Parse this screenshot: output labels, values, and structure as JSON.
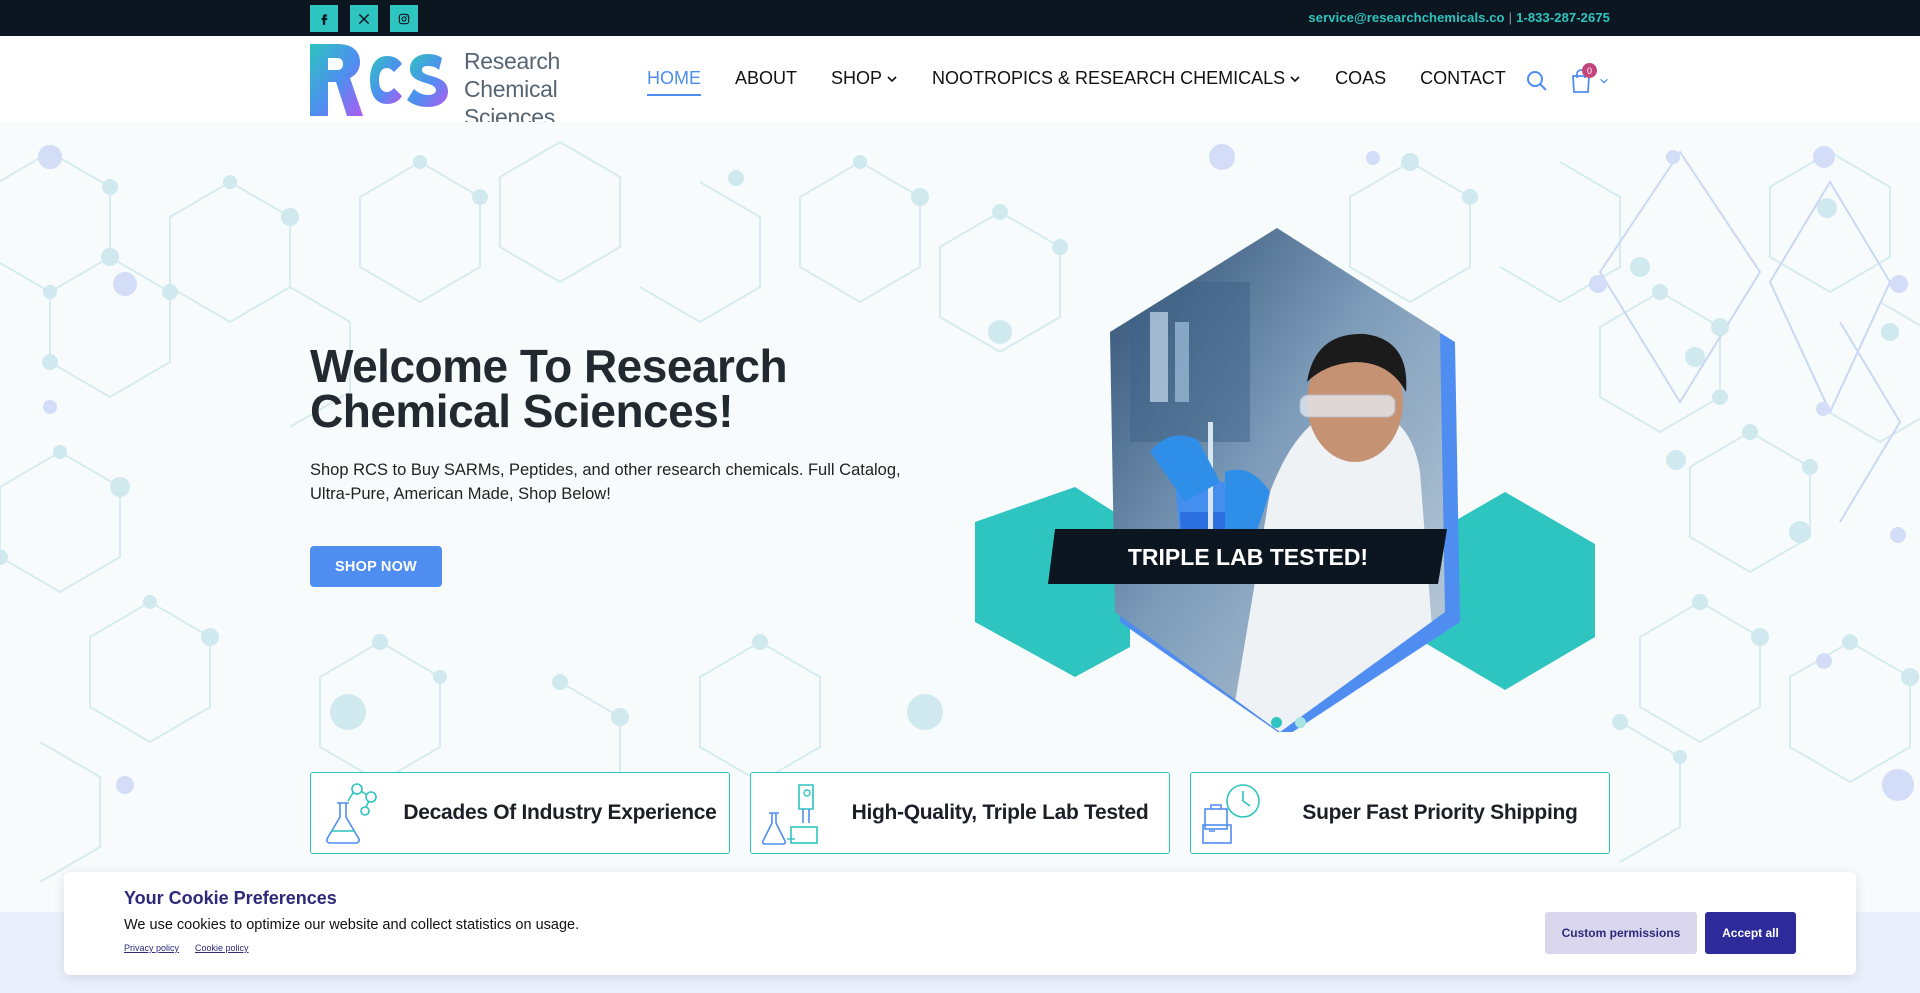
{
  "topbar": {
    "socials": [
      {
        "icon": "facebook-icon",
        "glyph": "f"
      },
      {
        "icon": "x-icon",
        "glyph": "𝕏"
      },
      {
        "icon": "instagram-icon",
        "glyph": "◎"
      }
    ],
    "email": "service@researchchemicals.co",
    "separator": "|",
    "phone": "1-833-287-2675"
  },
  "logo": {
    "line1": "Research",
    "line2": "Chemical",
    "line3": "Sciences"
  },
  "nav": {
    "items": [
      {
        "label": "HOME",
        "active": true
      },
      {
        "label": "ABOUT"
      },
      {
        "label": "SHOP",
        "dropdown": true
      },
      {
        "label": "NOOTROPICS & RESEARCH CHEMICALS",
        "dropdown": true
      },
      {
        "label": "COAS"
      },
      {
        "label": "CONTACT"
      }
    ],
    "cart_count": "0"
  },
  "hero": {
    "title": "Welcome To Research Chemical Sciences!",
    "subtitle": "Shop RCS to Buy SARMs, Peptides, and other research chemicals. Full Catalog, Ultra-Pure, American Made, Shop Below!",
    "button": "SHOP NOW",
    "banner": "TRIPLE LAB TESTED!",
    "slides_total": 2,
    "slide_active": 1
  },
  "features": [
    {
      "label": "Decades Of Industry Experience",
      "icon": "flask-molecule-icon"
    },
    {
      "label": "High-Quality, Triple Lab Tested",
      "icon": "lab-equipment-icon"
    },
    {
      "label": "Super Fast Priority Shipping",
      "icon": "package-clock-icon"
    }
  ],
  "cookie": {
    "title": "Your Cookie Preferences",
    "text": "We use cookies to optimize our website and collect statistics on usage.",
    "privacy_link": "Privacy policy",
    "cookie_link": "Cookie policy",
    "custom_button": "Custom permissions",
    "accept_button": "Accept all"
  },
  "colors": {
    "teal": "#2ec4c0",
    "blue": "#4f8df0",
    "navy": "#2d2a7a",
    "topbar": "#0c1620"
  }
}
